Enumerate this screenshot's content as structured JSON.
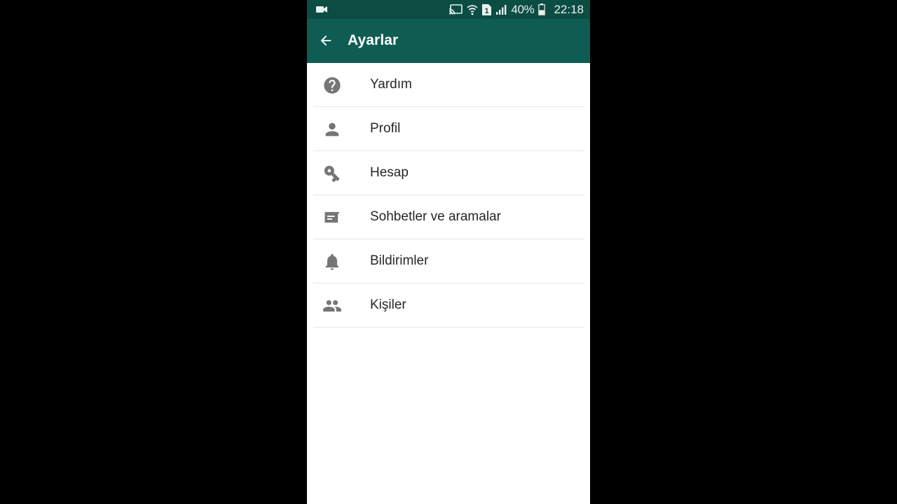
{
  "status_bar": {
    "battery": "40%",
    "time": "22:18",
    "sim_slot": "1"
  },
  "app_bar": {
    "title": "Ayarlar"
  },
  "settings": {
    "items": [
      {
        "label": "Yardım",
        "icon": "help-icon"
      },
      {
        "label": "Profil",
        "icon": "person-icon"
      },
      {
        "label": "Hesap",
        "icon": "key-icon"
      },
      {
        "label": "Sohbetler ve aramalar",
        "icon": "chat-icon"
      },
      {
        "label": "Bildirimler",
        "icon": "bell-icon"
      },
      {
        "label": "Kişiler",
        "icon": "contacts-icon"
      }
    ]
  },
  "colors": {
    "status_bar": "#0b4c43",
    "app_bar": "#0f5c52",
    "icon": "#757575",
    "text": "#262626"
  }
}
